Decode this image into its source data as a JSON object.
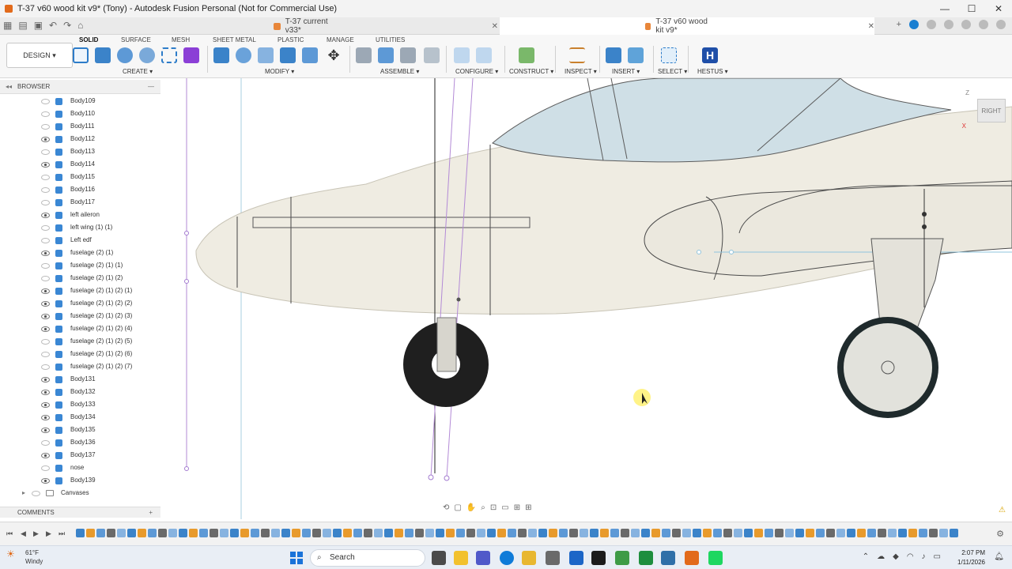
{
  "window": {
    "title": "T-37 v60 wood kit v9* (Tony) - Autodesk Fusion Personal (Not for Commercial Use)",
    "controls": [
      "—",
      "☐",
      "✕"
    ]
  },
  "tabs": [
    {
      "label": "T-37 current v33*",
      "active": false
    },
    {
      "label": "T-37 v60 wood kit v9*",
      "active": true
    }
  ],
  "ribbon": {
    "workspace": "DESIGN ▾",
    "tabs": [
      "SOLID",
      "SURFACE",
      "MESH",
      "SHEET METAL",
      "PLASTIC",
      "MANAGE",
      "UTILITIES"
    ],
    "groups": [
      "CREATE ▾",
      "MODIFY ▾",
      "ASSEMBLE ▾",
      "CONFIGURE ▾",
      "CONSTRUCT ▾",
      "INSPECT ▾",
      "INSERT ▾",
      "SELECT ▾",
      "HESTUS ▾"
    ]
  },
  "browser": {
    "header": "BROWSER",
    "items": [
      {
        "label": "Body109",
        "visible": false
      },
      {
        "label": "Body110",
        "visible": false
      },
      {
        "label": "Body111",
        "visible": false
      },
      {
        "label": "Body112",
        "visible": true
      },
      {
        "label": "Body113",
        "visible": false
      },
      {
        "label": "Body114",
        "visible": true
      },
      {
        "label": "Body115",
        "visible": false
      },
      {
        "label": "Body116",
        "visible": false
      },
      {
        "label": "Body117",
        "visible": false
      },
      {
        "label": "left aileron",
        "visible": true
      },
      {
        "label": "left wing (1) (1)",
        "visible": false
      },
      {
        "label": "Left edf",
        "visible": false
      },
      {
        "label": "fuselage (2) (1)",
        "visible": true
      },
      {
        "label": "fuselage (2) (1) (1)",
        "visible": false
      },
      {
        "label": "fuselage (2) (1) (2)",
        "visible": false
      },
      {
        "label": "fuselage (2) (1) (2) (1)",
        "visible": true
      },
      {
        "label": "fuselage (2) (1) (2) (2)",
        "visible": true
      },
      {
        "label": "fuselage (2) (1) (2) (3)",
        "visible": true
      },
      {
        "label": "fuselage (2) (1) (2) (4)",
        "visible": true
      },
      {
        "label": "fuselage (2) (1) (2) (5)",
        "visible": false
      },
      {
        "label": "fuselage (2) (1) (2) (6)",
        "visible": false
      },
      {
        "label": "fuselage (2) (1) (2) (7)",
        "visible": false
      },
      {
        "label": "Body131",
        "visible": true
      },
      {
        "label": "Body132",
        "visible": true
      },
      {
        "label": "Body133",
        "visible": true
      },
      {
        "label": "Body134",
        "visible": true
      },
      {
        "label": "Body135",
        "visible": true
      },
      {
        "label": "Body136",
        "visible": false
      },
      {
        "label": "Body137",
        "visible": true
      },
      {
        "label": "nose",
        "visible": false
      },
      {
        "label": "Body139",
        "visible": true
      }
    ],
    "canvases_label": "Canvases"
  },
  "comments_label": "COMMENTS",
  "viewcube": {
    "face": "RIGHT",
    "axis_z": "Z",
    "axis_x": "X"
  },
  "taskbar": {
    "weather_temp": "61°F",
    "weather_cond": "Windy",
    "search_placeholder": "Search",
    "time": "2:07 PM",
    "date": "1/11/2026"
  },
  "colors": {
    "fuselage": "#efece2",
    "canopy": "#cfdfe6",
    "tire": "#1f1f1f",
    "accent": "#0696d7"
  }
}
